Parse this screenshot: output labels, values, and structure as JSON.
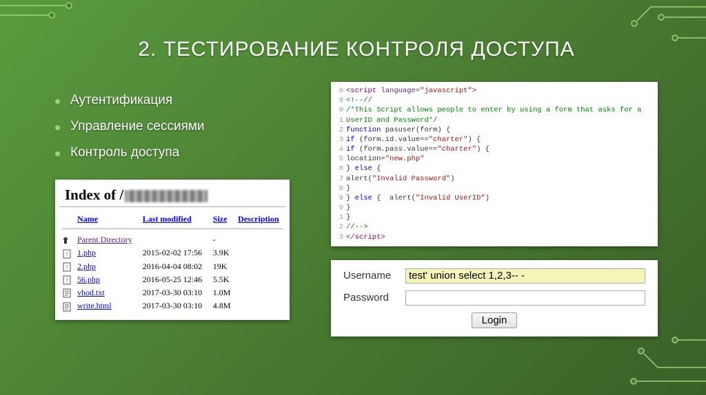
{
  "title": "2. ТЕСТИРОВАНИЕ КОНТРОЛЯ ДОСТУПА",
  "bullets": [
    "Аутентификация",
    "Управление сессиями",
    "Контроль доступа"
  ],
  "directory": {
    "heading_prefix": "Index of /",
    "columns": {
      "name": "Name",
      "modified": "Last modified",
      "size": "Size",
      "desc": "Description"
    },
    "parent": "Parent Directory",
    "rows": [
      {
        "name": "1.php",
        "modified": "2015-02-02 17:56",
        "size": "3.9K"
      },
      {
        "name": "2.php",
        "modified": "2016-04-04 08:02",
        "size": "19K"
      },
      {
        "name": "56.php",
        "modified": "2016-05-25 12:46",
        "size": "5.5K"
      },
      {
        "name": "vhod.txt",
        "modified": "2017-03-30 03:10",
        "size": "1.0M"
      },
      {
        "name": "write.html",
        "modified": "2017-03-30 03:10",
        "size": "4.8M"
      }
    ]
  },
  "code": {
    "lines": [
      {
        "n": "8",
        "html": "<span class='tag'>&lt;script</span> <span class='attr'>language=</span><span class='str'>\"javascript\"</span><span class='tag'>&gt;</span>"
      },
      {
        "n": "9",
        "html": "<span class='cm'>&lt;!--//</span>"
      },
      {
        "n": "0",
        "html": "<span class='cm'>/*This Script allows people to enter by using a form that asks for a</span>"
      },
      {
        "n": "1",
        "html": "<span class='cm'>UserID and Password*/</span>"
      },
      {
        "n": "2",
        "html": "<span class='kw'>function</span> pasuser(form) {"
      },
      {
        "n": "3",
        "html": "<span class='kw'>if</span> (form.id.value==<span class='str'>\"charter\"</span>) {"
      },
      {
        "n": "4",
        "html": "<span class='kw'>if</span> (form.pass.value==<span class='str'>\"charter\"</span>) {"
      },
      {
        "n": "5",
        "html": "location=<span class='str'>\"new.php\"</span>"
      },
      {
        "n": "6",
        "html": "} <span class='kw'>else</span> {"
      },
      {
        "n": "7",
        "html": "alert(<span class='str'>\"Invalid Password\"</span>)"
      },
      {
        "n": "8",
        "html": "}"
      },
      {
        "n": "9",
        "html": "} <span class='kw'>else</span> {  alert(<span class='str'>\"Invalid UserID\"</span>)"
      },
      {
        "n": "0",
        "html": "}"
      },
      {
        "n": "1",
        "html": "}"
      },
      {
        "n": "2",
        "html": "<span class='cm'>//--&gt;</span>"
      },
      {
        "n": "3",
        "html": "<span class='tag'>&lt;/script&gt;</span>"
      }
    ]
  },
  "login": {
    "username_label": "Username",
    "password_label": "Password",
    "username_value": "test' union select 1,2,3-- -",
    "password_value": "",
    "button": "Login"
  }
}
